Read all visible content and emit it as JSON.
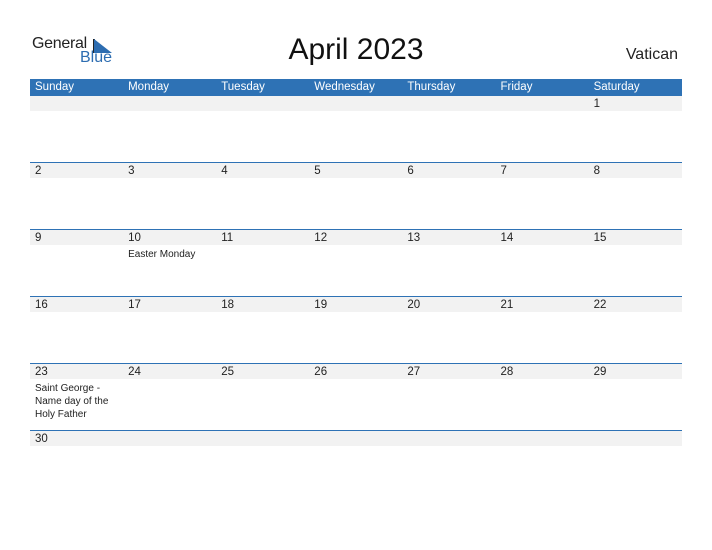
{
  "logo": {
    "general": "General",
    "blue": "Blue"
  },
  "title": "April 2023",
  "country": "Vatican",
  "colors": {
    "accent": "#2e72b5",
    "band": "#f2f2f2"
  },
  "weekdays": [
    "Sunday",
    "Monday",
    "Tuesday",
    "Wednesday",
    "Thursday",
    "Friday",
    "Saturday"
  ],
  "weeks": [
    [
      {
        "d": ""
      },
      {
        "d": ""
      },
      {
        "d": ""
      },
      {
        "d": ""
      },
      {
        "d": ""
      },
      {
        "d": ""
      },
      {
        "d": "1"
      }
    ],
    [
      {
        "d": "2"
      },
      {
        "d": "3"
      },
      {
        "d": "4"
      },
      {
        "d": "5"
      },
      {
        "d": "6"
      },
      {
        "d": "7"
      },
      {
        "d": "8"
      }
    ],
    [
      {
        "d": "9"
      },
      {
        "d": "10",
        "e": "Easter Monday"
      },
      {
        "d": "11"
      },
      {
        "d": "12"
      },
      {
        "d": "13"
      },
      {
        "d": "14"
      },
      {
        "d": "15"
      }
    ],
    [
      {
        "d": "16"
      },
      {
        "d": "17"
      },
      {
        "d": "18"
      },
      {
        "d": "19"
      },
      {
        "d": "20"
      },
      {
        "d": "21"
      },
      {
        "d": "22"
      }
    ],
    [
      {
        "d": "23",
        "e": "Saint George - Name day of the Holy Father"
      },
      {
        "d": "24"
      },
      {
        "d": "25"
      },
      {
        "d": "26"
      },
      {
        "d": "27"
      },
      {
        "d": "28"
      },
      {
        "d": "29"
      }
    ],
    [
      {
        "d": "30"
      }
    ]
  ]
}
